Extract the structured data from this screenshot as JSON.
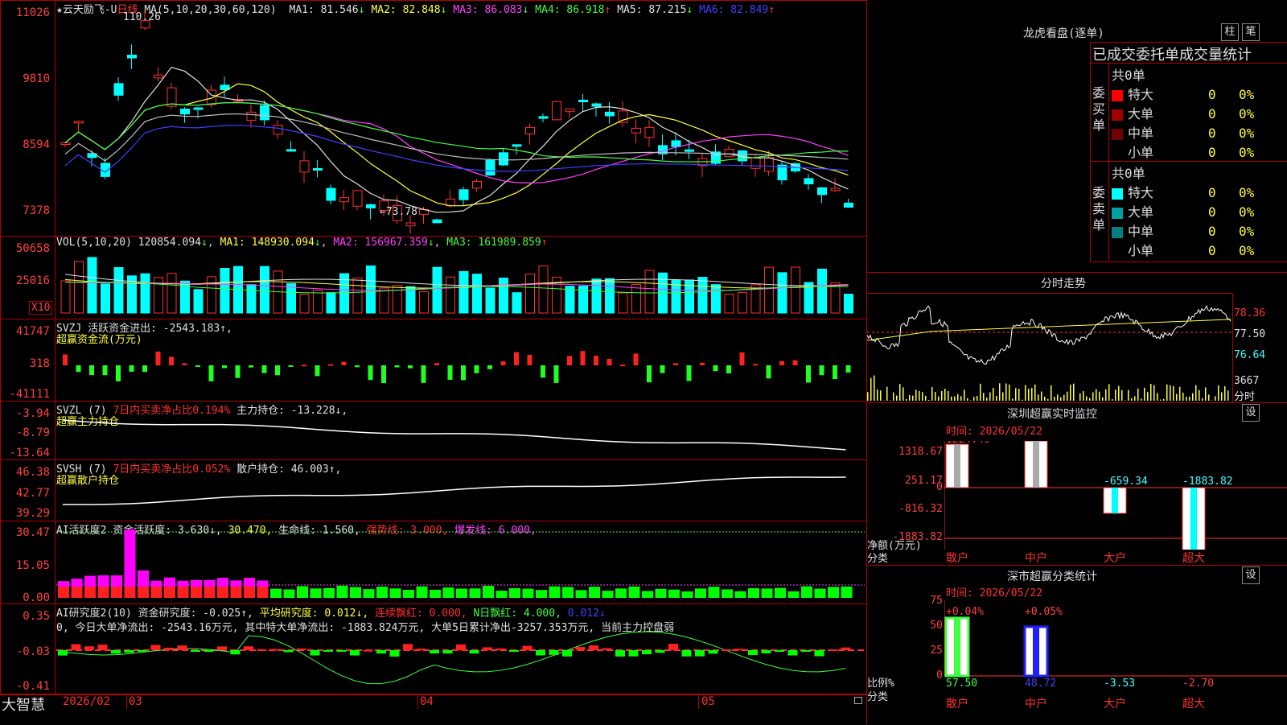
{
  "stock": {
    "name": "★云天励飞-U",
    "period": "日线",
    "ma_params": "MA(5,10,20,30,60,120)"
  },
  "main_chart": {
    "ma_values": [
      {
        "label": "MA1:",
        "value": "81.546",
        "arrow": "↓",
        "color": "#e0e0e0"
      },
      {
        "label": "MA2:",
        "value": "82.848",
        "arrow": "↓",
        "color": "#ffff40"
      },
      {
        "label": "MA3:",
        "value": "86.083",
        "arrow": "↓",
        "color": "#ff40ff"
      },
      {
        "label": "MA4:",
        "value": "86.918",
        "arrow": "↑",
        "color": "#40ff40"
      },
      {
        "label": "MA5:",
        "value": "87.215",
        "arrow": "↓",
        "color": "#e0e0e0"
      },
      {
        "label": "MA6:",
        "value": "82.849",
        "arrow": "↑",
        "color": "#4040ff"
      }
    ],
    "y_ticks": [
      "11026",
      "9810",
      "8594",
      "7378"
    ],
    "high_label": "110.26",
    "low_label": "←73.78"
  },
  "vol": {
    "header": "VOL(5,10,20)",
    "value": "120854.094",
    "arrow": "↓",
    "ma1": "MA1: 148930.094",
    "ma2": "MA2: 156967.359",
    "ma3": "MA3: 161989.859",
    "ma3_arrow": "↑",
    "y_ticks": [
      "50658",
      "25016"
    ],
    "unit": "X10"
  },
  "svzj": {
    "header": "SVZJ  活跃资金进出: -2543.183↑,",
    "sub": "超赢资金流(万元)",
    "y_ticks": [
      "41747",
      "318",
      "-41111"
    ]
  },
  "svzl": {
    "header": "SVZL (7) ",
    "ratio": "7日内买卖净占比0.194%",
    "hold": "主力持仓: -13.228↓,",
    "sub": "超赢主力持仓",
    "y_ticks": [
      "-3.94",
      "-8.79",
      "-13.64"
    ]
  },
  "svsh": {
    "header": "SVSH (7) ",
    "ratio": "7日内买卖净占比0.052%",
    "hold": "散户持仓: 46.003↑,",
    "sub": "超赢散户持仓",
    "y_ticks": [
      "46.38",
      "42.77",
      "39.29"
    ]
  },
  "ai_active": {
    "header": "AI活跃度2 资金活跃度: 3.630↓, ",
    "v2": "30.470,",
    "life": "生命线: 1.560,",
    "strong": "强势线: 3.000,",
    "burst": "爆发线: 6.000,",
    "y_ticks": [
      "30.47",
      "15.05",
      "0.00"
    ]
  },
  "ai_research": {
    "header": "AI研究度2(10) 资金研究度: -0.025↑, ",
    "avg": "平均研究度: 0.012↓,",
    "lian": "连续飘红: 0.000,",
    "nday": "N日飘红: 4.000,",
    "last": "0.012↓",
    "note": "0, 今日大单净流出: -2543.16万元, 其中特大单净流出: -1883.824万元, 大单5日累计净出-3257.353万元, 当前主力控盘弱",
    "y_ticks": [
      "0.35",
      "-0.03",
      "-0.41"
    ]
  },
  "x_axis": {
    "labels": [
      "2026/02",
      "03",
      "04",
      "05"
    ]
  },
  "brand": "大智慧",
  "right": {
    "title": "龙虎看盘(逐单)",
    "btn1": "柱",
    "btn2": "笔",
    "tabs": "已成交委托单成交量统计",
    "buy_label": "委买单",
    "sell_label": "委卖单",
    "buy_total": "共0单",
    "sell_total": "共0单",
    "buy_rows": [
      {
        "name": "特大",
        "v": "0",
        "p": "0%",
        "color": "#ff0000"
      },
      {
        "name": "大单",
        "v": "0",
        "p": "0%",
        "color": "#a00000"
      },
      {
        "name": "中单",
        "v": "0",
        "p": "0%",
        "color": "#700000"
      },
      {
        "name": "小单",
        "v": "0",
        "p": "0%",
        "color": "#000000"
      }
    ],
    "sell_rows": [
      {
        "name": "特大",
        "v": "0",
        "p": "0%",
        "color": "#00ffff"
      },
      {
        "name": "大单",
        "v": "0",
        "p": "0%",
        "color": "#00a0a0"
      },
      {
        "name": "中单",
        "v": "0",
        "p": "0%",
        "color": "#008080"
      },
      {
        "name": "小单",
        "v": "0",
        "p": "0%",
        "color": "#000000"
      }
    ],
    "fenshi": {
      "title": "分时走势",
      "y_ticks": [
        "78.36",
        "77.50",
        "76.64"
      ],
      "vol": "3667",
      "unit": "分时"
    },
    "monitor": {
      "title": "深圳超赢实时监控",
      "btn": "设",
      "time": "时间: 2026/05/22",
      "y_ticks": [
        "1318.67",
        "251.17",
        "0",
        "-816.32",
        "-1883.82"
      ],
      "y_label": "净额(万元)",
      "x_label": "分类",
      "bars": [
        {
          "cat": "散户",
          "value": "1224.49"
        },
        {
          "cat": "中户",
          "value": "1318.67"
        },
        {
          "cat": "大户",
          "value": "-659.34"
        },
        {
          "cat": "超大",
          "value": "-1883.82"
        }
      ]
    },
    "classify": {
      "title": "深市超赢分类统计",
      "btn": "设",
      "time": "时间: 2026/05/22",
      "y_ticks": [
        "75",
        "50",
        "25",
        "0"
      ],
      "y_label": "比例%",
      "x_label": "分类",
      "bars": [
        {
          "cat": "散户",
          "value": "57.50",
          "chg": "+0.04%"
        },
        {
          "cat": "中户",
          "value": "48.72",
          "chg": "+0.05%"
        },
        {
          "cat": "大户",
          "value": "-3.53",
          "chg": ""
        },
        {
          "cat": "超大",
          "value": "-2.70",
          "chg": ""
        }
      ]
    }
  }
}
